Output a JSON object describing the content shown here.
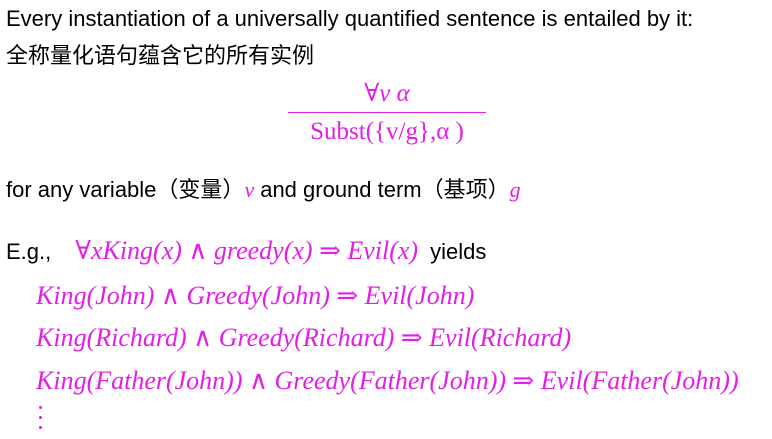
{
  "intro": {
    "english": "Every instantiation of a universally quantified sentence is entailed by it:",
    "chinese": "全称量化语句蕴含它的所有实例"
  },
  "rule": {
    "premise": "∀v  α",
    "conclusion": "Subst({v/g},α )"
  },
  "condition": {
    "prefix": "for any variable",
    "var_cn": "（变量）",
    "var_symbol": "v",
    "middle": "and ground term",
    "term_cn": "（基项）",
    "term_symbol": "g"
  },
  "example": {
    "label": "E.g.,",
    "sentence": "∀xKing(x) ∧ greedy(x) ⇒ Evil(x)",
    "suffix": "yields",
    "instances": [
      "King(John) ∧ Greedy(John) ⇒ Evil(John)",
      "King(Richard) ∧ Greedy(Richard) ⇒ Evil(Richard)",
      "King(Father(John)) ∧ Greedy(Father(John)) ⇒ Evil(Father(John))"
    ],
    "continuation": "⋮"
  },
  "colors": {
    "text": "#000000",
    "math": "#e31ee6",
    "background": "#ffffff"
  }
}
